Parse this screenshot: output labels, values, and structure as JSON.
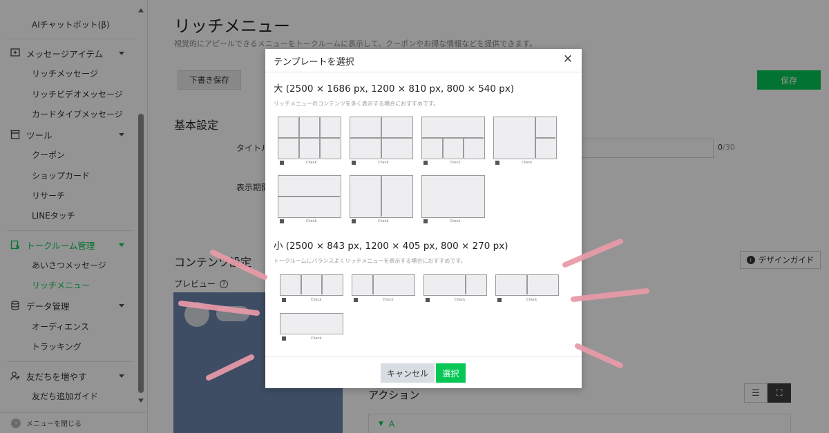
{
  "sidebar": {
    "ai_chatbot": "AIチャットボット(β)",
    "message_items": {
      "label": "メッセージアイテム",
      "items": [
        "リッチメッセージ",
        "リッチビデオメッセージ",
        "カードタイプメッセージ"
      ]
    },
    "tools": {
      "label": "ツール",
      "items": [
        "クーポン",
        "ショップカード",
        "リサーチ",
        "LINEタッチ"
      ]
    },
    "talkroom": {
      "label": "トークルーム管理",
      "items": [
        "あいさつメッセージ",
        "リッチメニュー"
      ]
    },
    "data_mgmt": {
      "label": "データ管理",
      "items": [
        "オーディエンス",
        "トラッキング"
      ]
    },
    "friends": {
      "label": "友だちを増やす",
      "items": [
        "友だち追加ガイド"
      ]
    },
    "close_menu": "メニューを閉じる"
  },
  "main": {
    "title": "リッチメニュー",
    "description": "視覚的にアピールできるメニューをトークルームに表示して、クーポンやお得な情報などを提供できます。",
    "draft_button": "下書き保存",
    "save_button": "保存",
    "basic_settings": "基本設定",
    "title_label": "タイトル",
    "display_period_label": "表示期間",
    "counter_current": "0",
    "counter_max": "/30",
    "content_settings": "コンテンツ設定",
    "design_guide": "デザインガイド",
    "preview_label": "プレビュー",
    "action_title": "アクション",
    "action_row_label": "A"
  },
  "modal": {
    "title": "テンプレートを選択",
    "large": {
      "heading": "大 (2500 × 1686 px, 1200 × 810 px, 800 × 540 px)",
      "description": "リッチメニューのコンテンツを多く表示する場合におすすめです。"
    },
    "small": {
      "heading": "小 (2500 × 843 px, 1200 × 405 px, 800 × 270 px)",
      "description": "トークルームにバランスよくリッチメニューを表示する場合におすすめです。"
    },
    "template_caption": "Check",
    "cancel_button": "キャンセル",
    "select_button": "選択"
  },
  "colors": {
    "accent": "#06c755",
    "overlay": "rgba(0,0,0,0.42)",
    "annotation": "#e89aa8"
  }
}
